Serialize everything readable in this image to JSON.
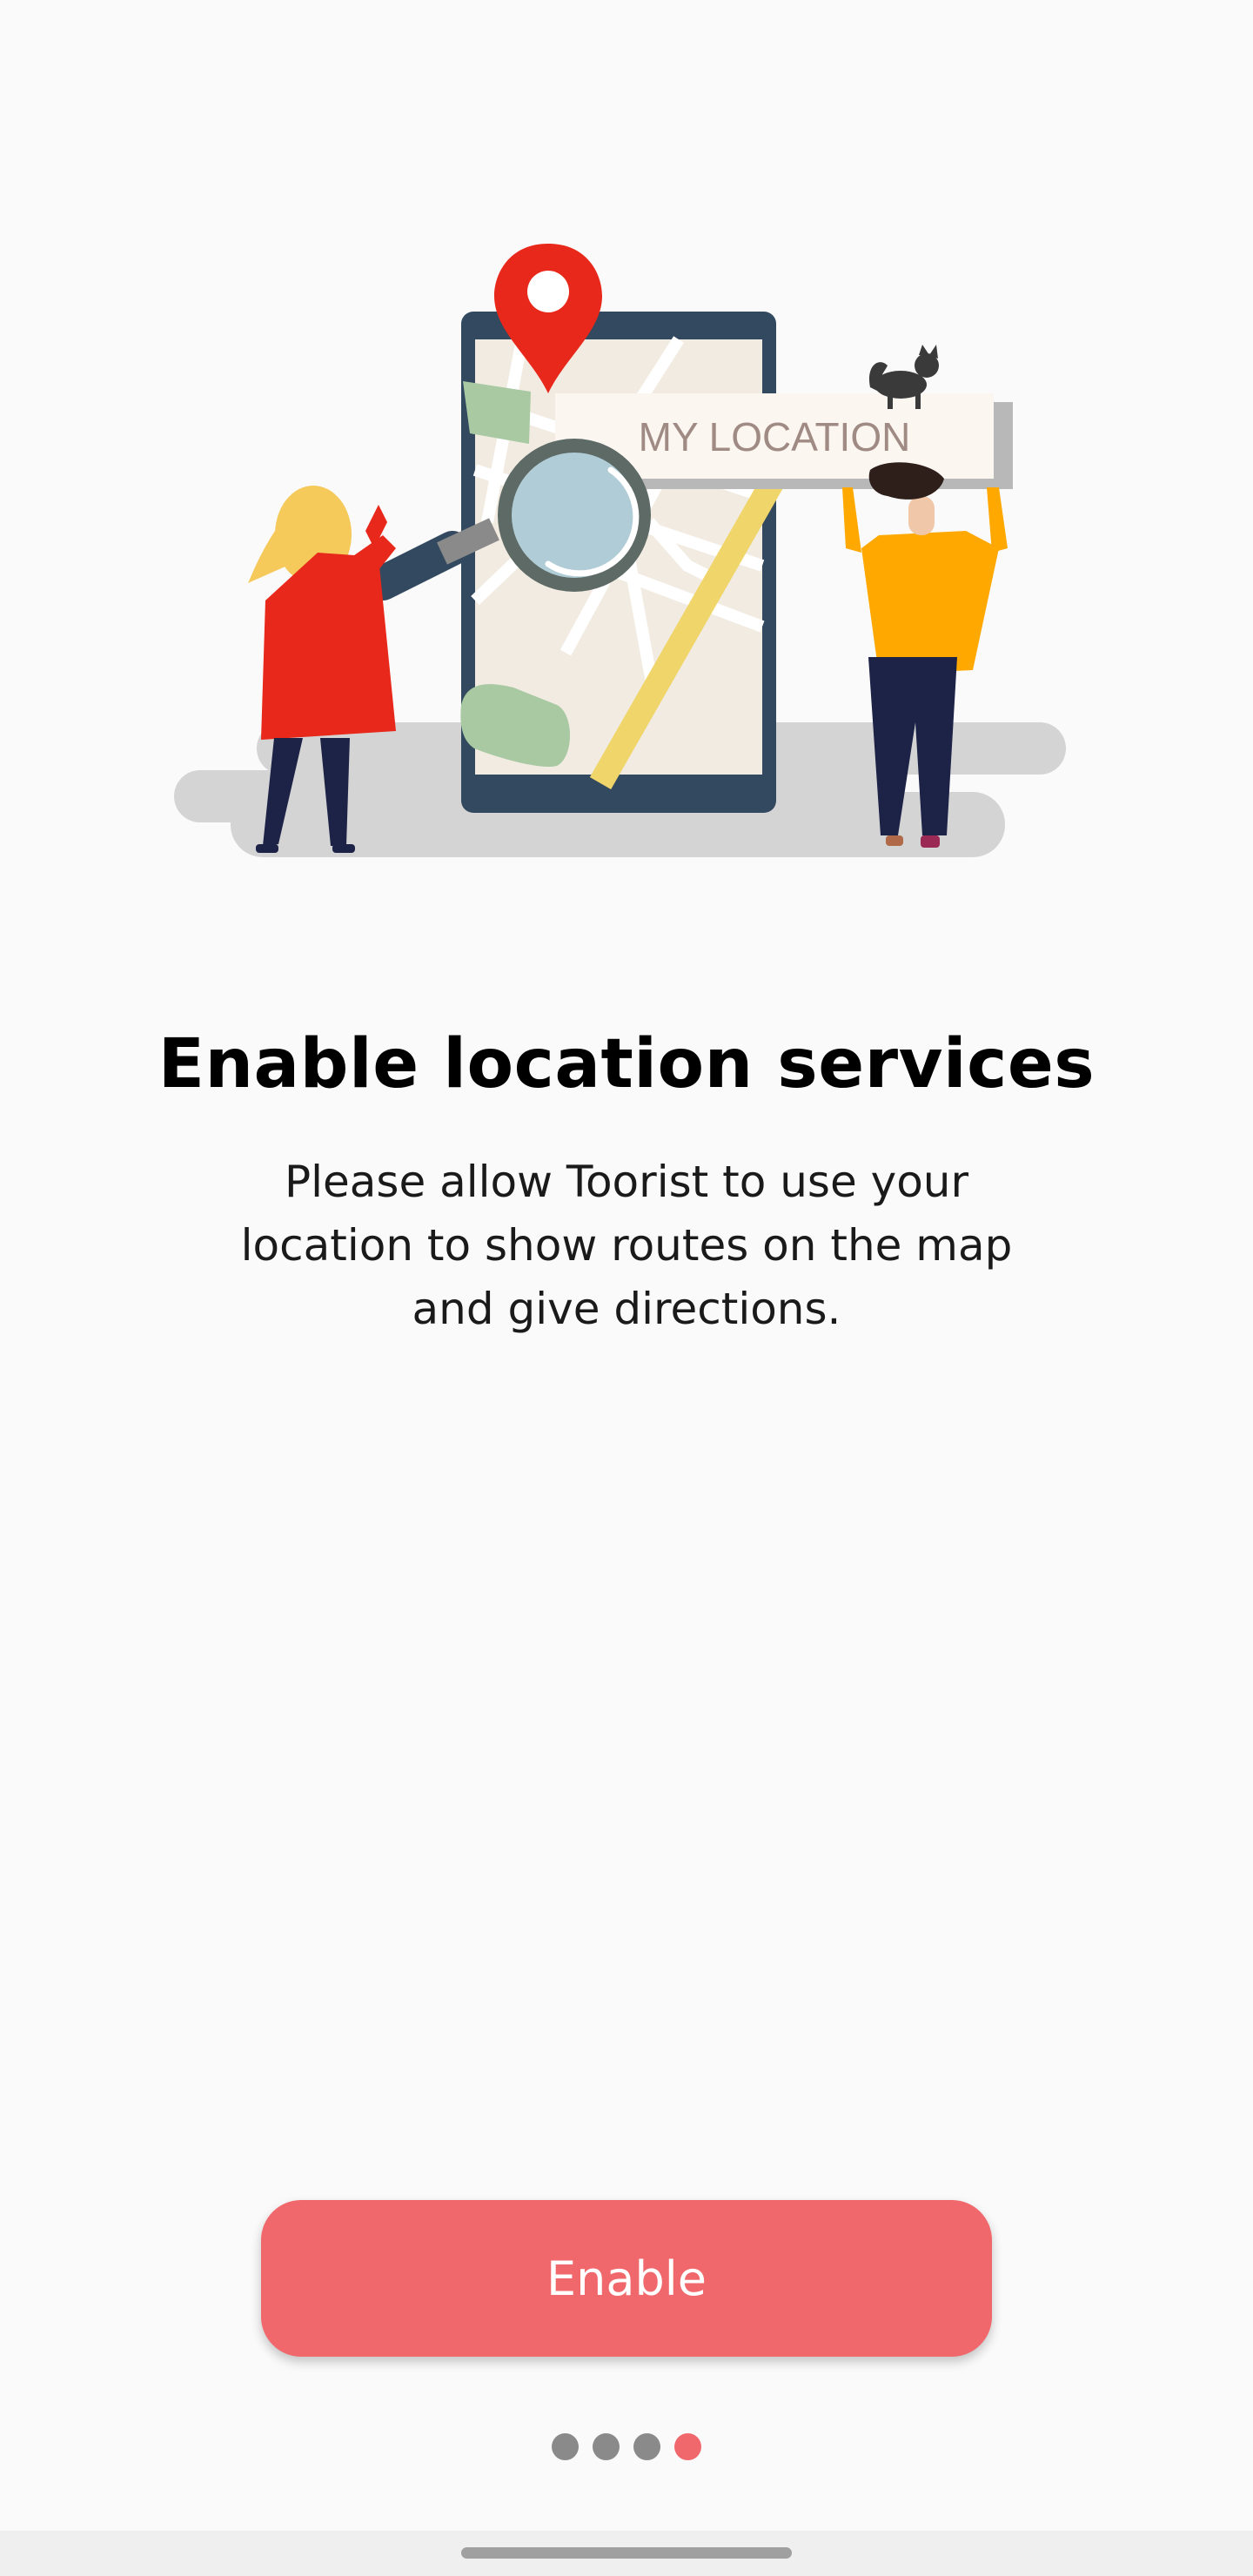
{
  "onboarding": {
    "illustration_sign": "MY LOCATION",
    "title": "Enable location services",
    "subtitle_lines": [
      "Please allow Toorist to use your",
      "location to show routes on the map",
      "and give directions."
    ],
    "enable_label": "Enable"
  },
  "pager": {
    "total": 4,
    "active_index": 3
  },
  "colors": {
    "accent": "#f0686b",
    "inactive_dot": "#8a8a8a",
    "background": "#fafafa"
  },
  "icons": [
    "location-pin-icon",
    "magnifier-icon"
  ]
}
